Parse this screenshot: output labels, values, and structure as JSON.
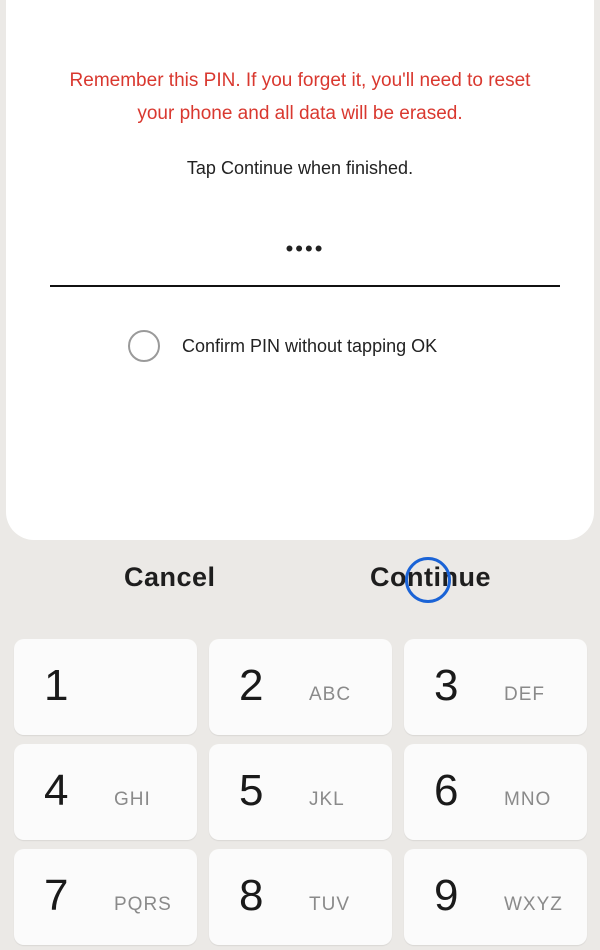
{
  "dialog": {
    "warning_line1": "Remember this PIN. If you forget it, you'll need to reset",
    "warning_line2": "your phone and all data will be erased.",
    "hint": "Tap Continue when finished.",
    "pin_masked": "••••",
    "confirm_option_label": "Confirm PIN without tapping OK"
  },
  "actions": {
    "cancel_label": "Cancel",
    "continue_label": "Continue"
  },
  "keypad": {
    "keys": [
      {
        "digit": "1",
        "letters": ""
      },
      {
        "digit": "2",
        "letters": "ABC"
      },
      {
        "digit": "3",
        "letters": "DEF"
      },
      {
        "digit": "4",
        "letters": "GHI"
      },
      {
        "digit": "5",
        "letters": "JKL"
      },
      {
        "digit": "6",
        "letters": "MNO"
      },
      {
        "digit": "7",
        "letters": "PQRS"
      },
      {
        "digit": "8",
        "letters": "TUV"
      },
      {
        "digit": "9",
        "letters": "WXYZ"
      }
    ]
  },
  "colors": {
    "warning": "#d9382f",
    "tap_indicator": "#1a63d6"
  }
}
